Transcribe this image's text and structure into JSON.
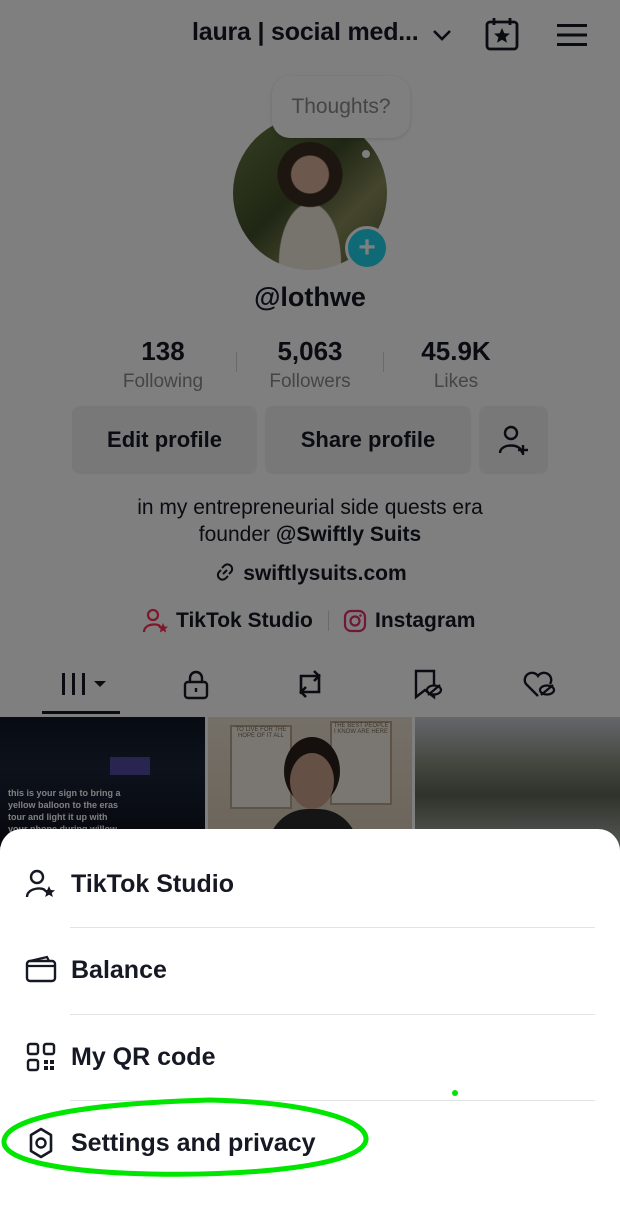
{
  "header": {
    "title": "laura | social med..."
  },
  "profile": {
    "bubble": "Thoughts?",
    "username": "@lothwe",
    "stats": [
      {
        "value": "138",
        "label": "Following"
      },
      {
        "value": "5,063",
        "label": "Followers"
      },
      {
        "value": "45.9K",
        "label": "Likes"
      }
    ],
    "buttons": {
      "edit": "Edit profile",
      "share": "Share profile"
    },
    "bio_line1": "in my entrepreneurial side quests era",
    "bio_line2_prefix": "founder ",
    "bio_line2_mention": "@Swiftly Suits",
    "website": "swiftlysuits.com",
    "studio_link": "TikTok Studio",
    "instagram_link": "Instagram"
  },
  "grid": {
    "video1_caption": "this is your sign to bring a yellow balloon to the eras tour and light it up with your phone during willow",
    "poster_left": "TO LIVE FOR THE HOPE OF IT ALL",
    "poster_right": "THE BEST PEOPLE I KNOW ARE HERE"
  },
  "sheet": {
    "items": [
      {
        "label": "TikTok Studio",
        "icon": "person-star-icon"
      },
      {
        "label": "Balance",
        "icon": "wallet-icon"
      },
      {
        "label": "My QR code",
        "icon": "qr-code-icon"
      },
      {
        "label": "Settings and privacy",
        "icon": "gear-icon"
      }
    ]
  },
  "colors": {
    "accent": "#20d5ec",
    "studio_red": "#fe2c55",
    "annotation": "#00e600"
  }
}
